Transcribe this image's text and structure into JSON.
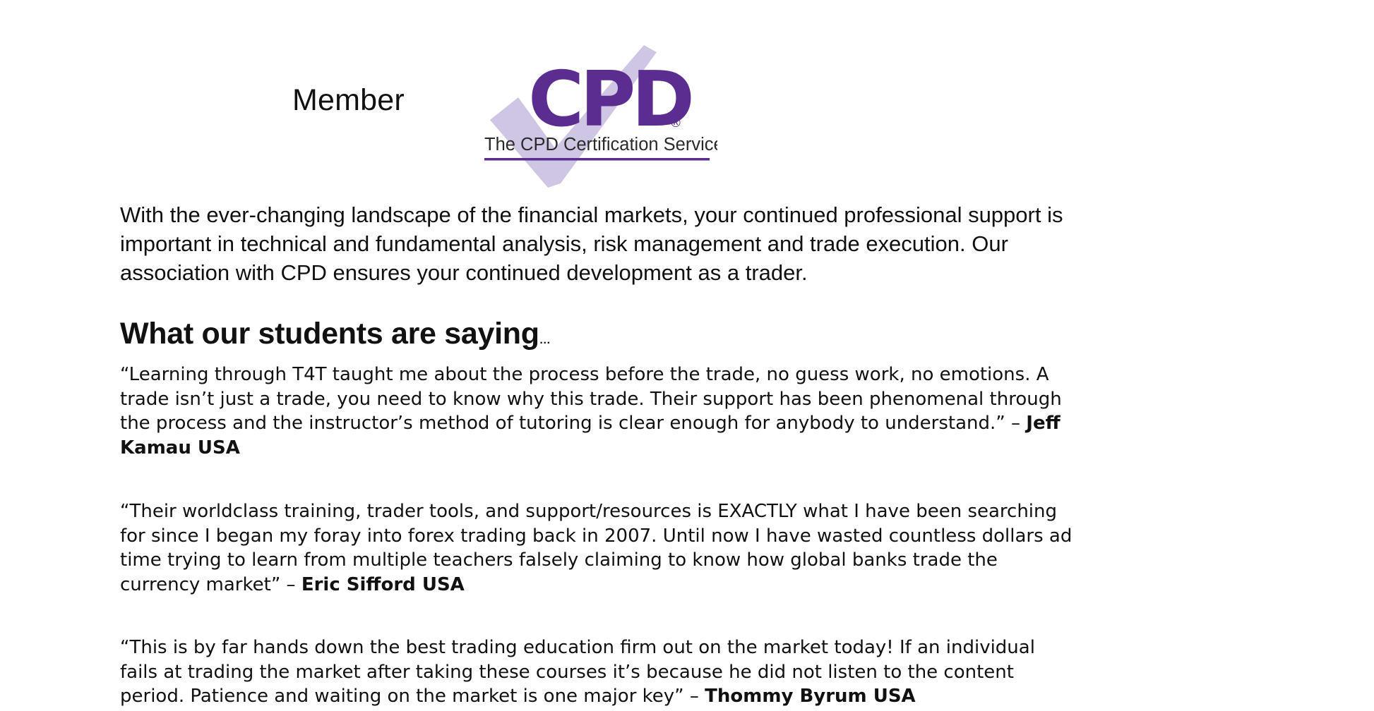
{
  "member_label": "Member",
  "logo": {
    "brand_text": "CPD",
    "registered_mark": "®",
    "caption": "The CPD Certification Service",
    "colors": {
      "purple": "#5b2d91",
      "check": "#cfc6e3"
    }
  },
  "intro_text": "With the ever-changing landscape of the financial markets, your continued professional support is important in technical and fundamental analysis, risk management and trade execution. Our association with CPD ensures your continued development as a trader.",
  "section_heading": "What our students are saying",
  "section_heading_suffix": "…",
  "testimonials": [
    {
      "quote": "“Learning through T4T taught me about the process before the trade, no guess work, no emotions. A trade isn’t just a trade, you need to know why this trade. Their support has been phenomenal through the process and the instructor’s method of tutoring is clear enough for anybody to understand.” – ",
      "author": "Jeff Kamau USA"
    },
    {
      "quote": "“Their worldclass training, trader tools, and support/resources is EXACTLY what I have been searching for since I began my foray into forex trading back in 2007. Until now I have wasted countless dollars ad time trying to learn from multiple teachers falsely claiming to know how global banks trade the currency market” – ",
      "author": "Eric Sifford USA"
    },
    {
      "quote": "“This is by far hands down the best trading education firm out on the market today! If an individual fails at trading the market after taking these courses it’s because he did not listen to the content period. Patience and waiting on the market is one major key” – ",
      "author": "Thommy Byrum USA"
    }
  ]
}
